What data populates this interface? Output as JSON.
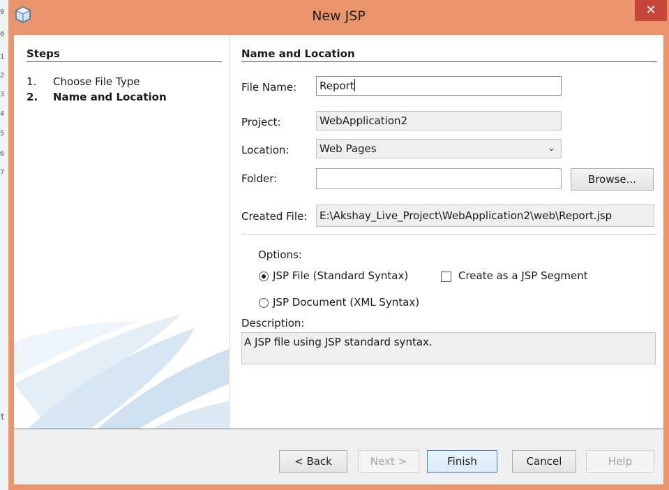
{
  "background_window": {
    "line_numbers": [
      "9",
      "0",
      "1",
      "2",
      "3",
      "4",
      "5",
      "6",
      "7"
    ],
    "fragment": "t"
  },
  "window": {
    "title": "New JSP",
    "close_glyph": "✕",
    "app_icon": "netbeans-cube-icon",
    "title_bar_color": "#e9946a"
  },
  "steps": {
    "title": "Steps",
    "items": [
      {
        "num": "1.",
        "label": "Choose File Type"
      },
      {
        "num": "2.",
        "label": "Name and Location"
      }
    ]
  },
  "form": {
    "section_title": "Name and Location",
    "file_name": {
      "label": "File Name:",
      "value": "Report"
    },
    "project": {
      "label": "Project:",
      "value": "WebApplication2"
    },
    "location": {
      "label": "Location:",
      "value": "Web Pages",
      "icon": "chevron-down-icon"
    },
    "folder": {
      "label": "Folder:",
      "value": "",
      "browse_label": "Browse..."
    },
    "created_file": {
      "label": "Created File:",
      "value": "E:\\Akshay_Live_Project\\WebApplication2\\web\\Report.jsp"
    },
    "options": {
      "label": "Options:",
      "jsp_file": {
        "label": "JSP File (Standard Syntax)",
        "selected": true
      },
      "jsp_document": {
        "label": "JSP Document (XML Syntax)",
        "selected": false
      },
      "segment": {
        "label": "Create as a JSP Segment",
        "checked": false
      }
    },
    "description": {
      "label": "Description:",
      "text": "A JSP file using JSP standard syntax."
    }
  },
  "buttons": {
    "back": "< Back",
    "next": "Next >",
    "finish": "Finish",
    "cancel": "Cancel",
    "help": "Help"
  }
}
